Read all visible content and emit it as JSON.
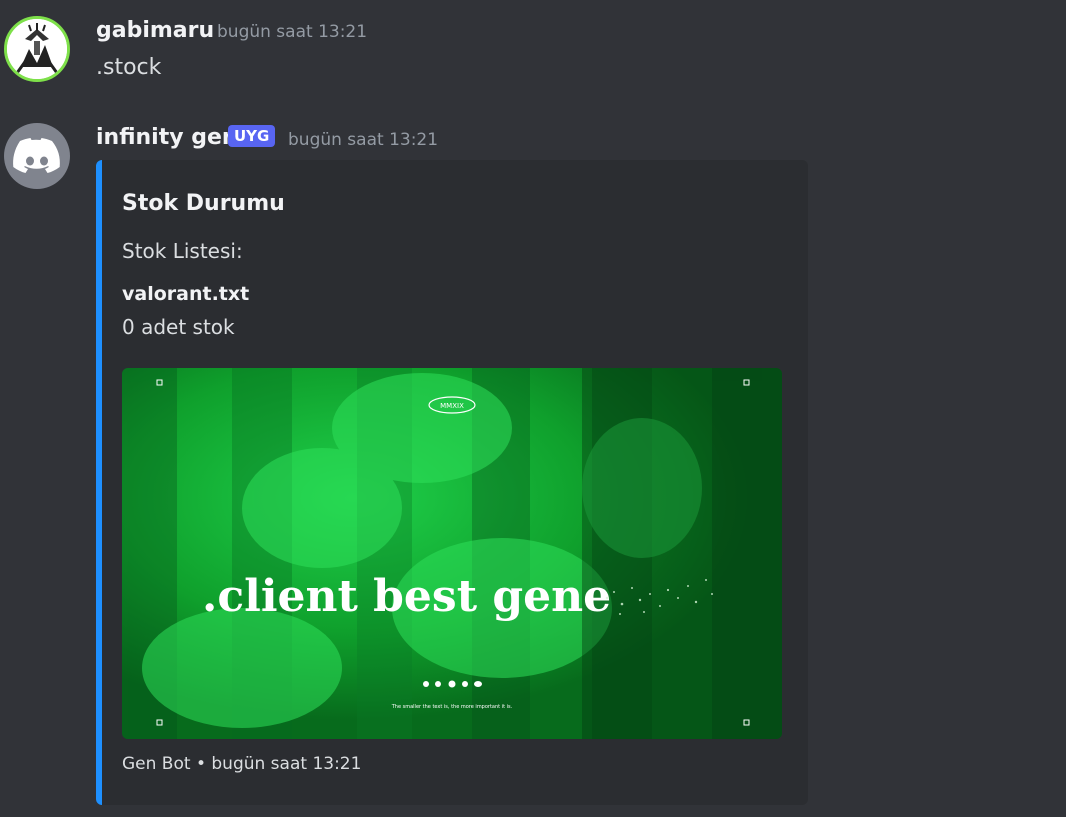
{
  "messages": [
    {
      "username": "gabimaru",
      "timestamp": "bugün saat 13:21",
      "content": ".stock",
      "avatar_icon": "manga-avatar-icon"
    },
    {
      "username": "infinity gen",
      "badge": "UYG",
      "timestamp": "bugün saat 13:21",
      "avatar_icon": "discord-logo-icon",
      "embed": {
        "accent_color": "#1e90ff",
        "title": "Stok Durumu",
        "description": "Stok Listesi:",
        "field_name": "valorant.txt",
        "field_value": "0 adet stok",
        "image": {
          "headline": ".client best gene",
          "top_badge": "MMXIX",
          "tagline": "The smaller the text is, the more important it is.",
          "accent_color": "#11a82f"
        },
        "footer": "Gen Bot • bugün saat 13:21"
      }
    }
  ],
  "colors": {
    "background": "#313338",
    "embed_background": "#2b2d31",
    "bot_badge": "#5865f2",
    "timestamp": "#949ba4"
  }
}
